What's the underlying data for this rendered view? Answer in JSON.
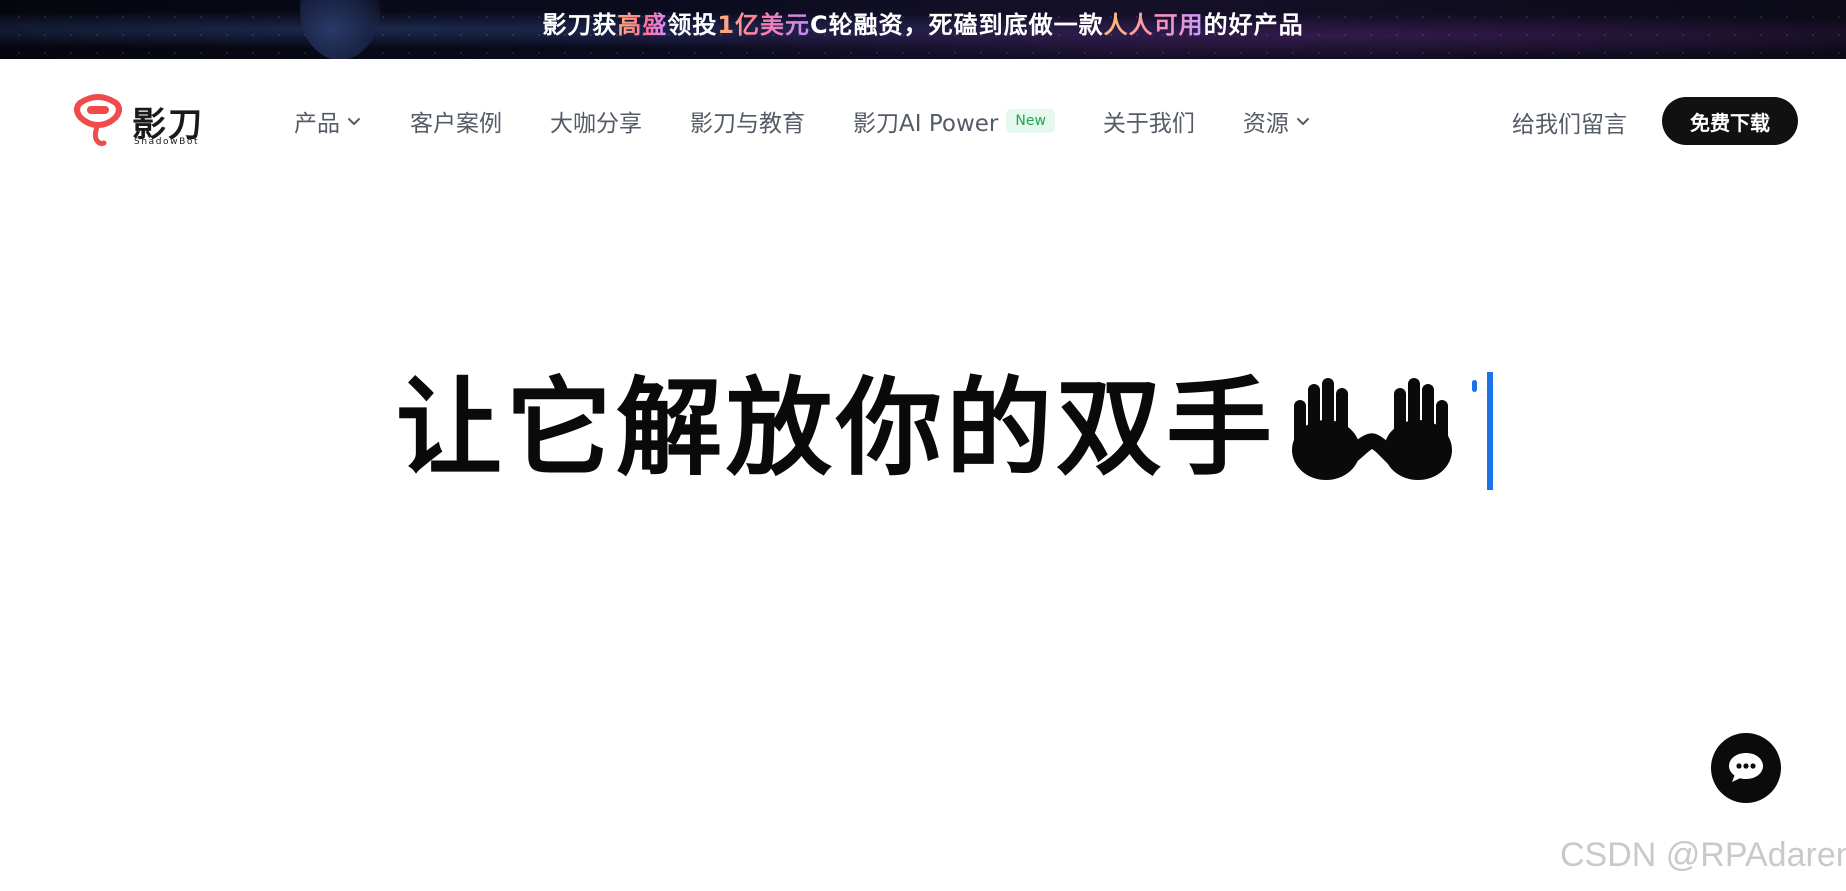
{
  "banner": {
    "text_parts": {
      "p1": "影刀获",
      "h1": "高盛",
      "p2": "领投",
      "h2": "1亿美元",
      "p3": "C轮融资，死磕到底做一款",
      "h3": "人人可用",
      "p4": "的好产品"
    }
  },
  "header": {
    "logo": {
      "title": "影刀",
      "subtitle": "ShadowBot",
      "icon": "shadowbot-logo-icon"
    },
    "nav": [
      {
        "label": "产品",
        "dropdown": true
      },
      {
        "label": "客户案例"
      },
      {
        "label": "大咖分享"
      },
      {
        "label": "影刀与教育"
      },
      {
        "label": "影刀AI Power",
        "badge": "New"
      },
      {
        "label": "关于我们"
      },
      {
        "label": "资源",
        "dropdown": true
      }
    ],
    "message_link": "给我们留言",
    "download_button": "免费下载"
  },
  "hero": {
    "title": "让它解放你的双手",
    "emoji": "hands-icon"
  },
  "floating": {
    "chat_icon": "chat-bubble-icon"
  },
  "watermark": "CSDN @RPAdaren",
  "colors": {
    "accent_blue": "#1a73e8",
    "brand_red": "#ef4b4b",
    "badge_green": "#22a559",
    "nav_text": "#555b66"
  }
}
